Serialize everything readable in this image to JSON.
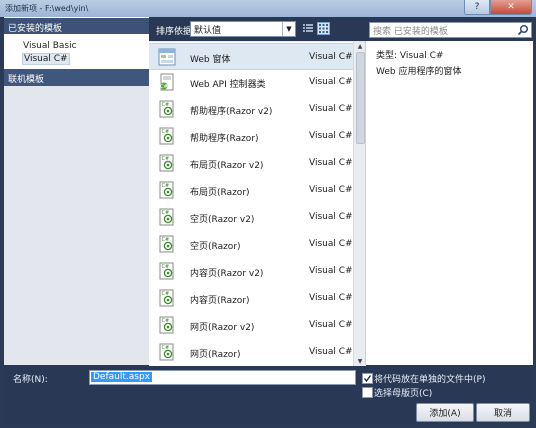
{
  "window": {
    "title": "添加新项 - F:\\wed\\yin\\",
    "help_label": "?",
    "close_label": "✕"
  },
  "left_pane": {
    "installed_header": "已安装的模板",
    "items": [
      {
        "label": "Visual Basic",
        "selected": false
      },
      {
        "label": "Visual C#",
        "selected": true
      }
    ],
    "online_header": "联机模板"
  },
  "toolbar": {
    "sort_label": "排序依据:",
    "sort_value": "默认值",
    "search_placeholder": "搜索 已安装的模板"
  },
  "templates": [
    {
      "name": "Web 窗体",
      "lang": "Visual C#",
      "icon": "web-form-icon",
      "selected": true
    },
    {
      "name": "Web API 控制器类",
      "lang": "Visual C#",
      "icon": "web-api-controller-icon",
      "selected": false
    },
    {
      "name": "帮助程序(Razor v2)",
      "lang": "Visual C#",
      "icon": "razor-page-icon",
      "selected": false
    },
    {
      "name": "帮助程序(Razor)",
      "lang": "Visual C#",
      "icon": "razor-page-icon",
      "selected": false
    },
    {
      "name": "布局页(Razor v2)",
      "lang": "Visual C#",
      "icon": "razor-page-icon",
      "selected": false
    },
    {
      "name": "布局页(Razor)",
      "lang": "Visual C#",
      "icon": "razor-page-icon",
      "selected": false
    },
    {
      "name": "空页(Razor v2)",
      "lang": "Visual C#",
      "icon": "razor-page-icon",
      "selected": false
    },
    {
      "name": "空页(Razor)",
      "lang": "Visual C#",
      "icon": "razor-page-icon",
      "selected": false
    },
    {
      "name": "内容页(Razor v2)",
      "lang": "Visual C#",
      "icon": "razor-page-icon",
      "selected": false
    },
    {
      "name": "内容页(Razor)",
      "lang": "Visual C#",
      "icon": "razor-page-icon",
      "selected": false
    },
    {
      "name": "网页(Razor v2)",
      "lang": "Visual C#",
      "icon": "razor-page-icon",
      "selected": false
    },
    {
      "name": "网页(Razor)",
      "lang": "Visual C#",
      "icon": "razor-page-icon",
      "selected": false
    }
  ],
  "details": {
    "type_line": "类型:  Visual C#",
    "description": "Web 应用程序的窗体"
  },
  "bottom": {
    "name_label": "名称(N):",
    "name_value": "Default.aspx",
    "separate_file_label": "将代码放在单独的文件中(P)",
    "separate_file_checked": true,
    "master_page_label": "选择母版页(C)",
    "master_page_checked": false,
    "add_button": "添加(A)",
    "cancel_button": "取消"
  },
  "colors": {
    "frame": "#293955",
    "selection": "#dde8f3",
    "header": "#3d5277",
    "name_highlight": "#3399ff"
  }
}
